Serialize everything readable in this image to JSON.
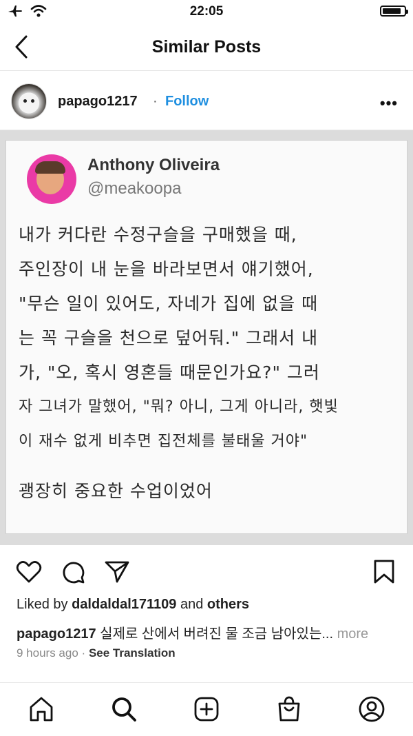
{
  "status_bar": {
    "time": "22:05",
    "battery_level": 0.85
  },
  "nav": {
    "title": "Similar Posts"
  },
  "post": {
    "username": "papago1217",
    "separator": "·",
    "follow_label": "Follow",
    "more_label": "•••"
  },
  "tweet": {
    "name": "Anthony Oliveira",
    "handle": "@meakoopa",
    "lines": [
      "내가 커다란 수정구슬을 구매했을 때,",
      "주인장이 내 눈을 바라보면서 얘기했어,",
      "\"무슨 일이 있어도, 자네가 집에 없을 때",
      "는 꼭 구슬을 천으로 덮어둬.\" 그래서 내",
      "가, \"오, 혹시 영혼들 때문인가요?\" 그러",
      "자 그녀가 말했어, \"뭐? 아니, 그게 아니라, 햇빛",
      "이 재수 없게 비추면 집전체를 불태울 거야\"",
      "괭장히 중요한 수업이었어"
    ]
  },
  "engagement": {
    "liked_by_prefix": "Liked by",
    "liked_by_user": "daldaldal171109",
    "and": "and",
    "others": "others"
  },
  "caption": {
    "user": "papago1217",
    "text": "실제로 산에서 버려진 물 조금 남아있는...",
    "more": "more"
  },
  "meta": {
    "time_ago": "9 hours ago",
    "dot": "·",
    "see_translation": "See Translation"
  }
}
